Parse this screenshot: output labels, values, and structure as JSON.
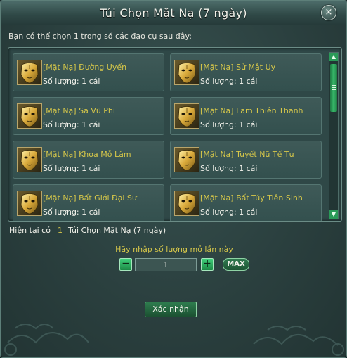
{
  "dialog": {
    "title": "Túi Chọn Mặt Nạ (7 ngày)",
    "close_glyph": "×",
    "prompt": "Bạn có thể chọn 1 trong số các đạo cụ sau đây:"
  },
  "items": [
    {
      "name": "[Mặt Nạ] Đường Uyển",
      "qty": "Số lượng: 1 cái",
      "icon": "golden-mask-icon"
    },
    {
      "name": "[Mặt Nạ] Sử Mật Uy",
      "qty": "Số lượng: 1 cái",
      "icon": "golden-mask-icon"
    },
    {
      "name": "[Mặt Nạ] Sa Vũ Phi",
      "qty": "Số lượng: 1 cái",
      "icon": "golden-mask-icon"
    },
    {
      "name": "[Mặt Nạ] Lam Thiên Thanh",
      "qty": "Số lượng: 1 cái",
      "icon": "golden-mask-icon"
    },
    {
      "name": "[Mặt Nạ] Khoa Mỗ Lâm",
      "qty": "Số lượng: 1 cái",
      "icon": "golden-mask-icon"
    },
    {
      "name": "[Mặt Nạ] Tuyết Nữ Tế Tư",
      "qty": "Số lượng: 1 cái",
      "icon": "golden-mask-icon"
    },
    {
      "name": "[Mặt Nạ] Bất Giới Đại Sư",
      "qty": "Số lượng: 1 cái",
      "icon": "golden-mask-icon"
    },
    {
      "name": "[Mặt Nạ] Bất Túy Tiên Sinh",
      "qty": "Số lượng: 1 cái",
      "icon": "golden-mask-icon"
    }
  ],
  "scrollbar": {
    "up_glyph": "▲",
    "down_glyph": "▼"
  },
  "status": {
    "prefix": "Hiện tại có",
    "count": "1",
    "item": "Túi Chọn Mặt Nạ (7 ngày)"
  },
  "quantity": {
    "prompt": "Hãy nhập số lượng mở lần này",
    "minus": "−",
    "plus": "+",
    "value": "1",
    "max_label": "MAX"
  },
  "confirm_label": "Xác nhận",
  "colors": {
    "accent_green": "#2a9a58",
    "highlight_yellow": "#d6c74a",
    "panel": "#2f4847"
  }
}
